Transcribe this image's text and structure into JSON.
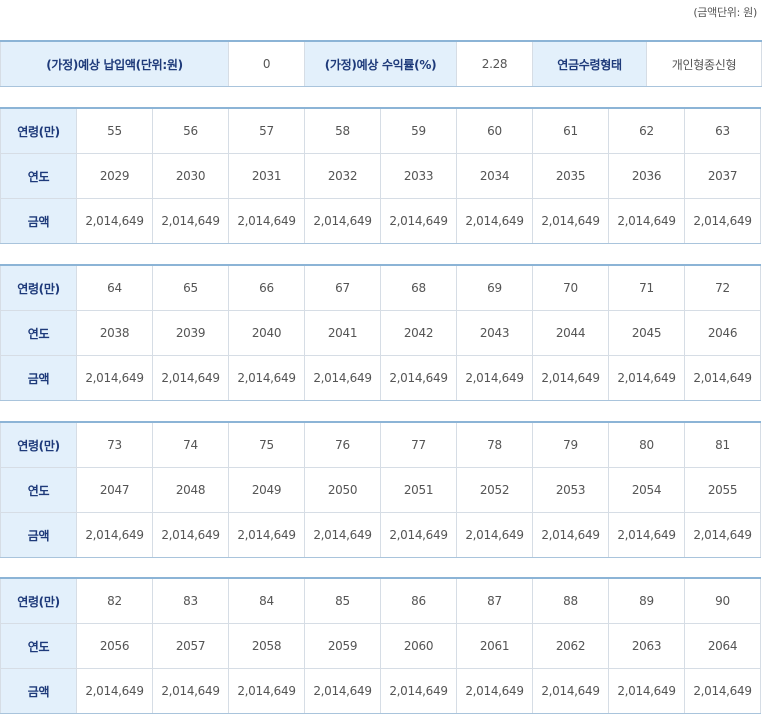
{
  "unit_note": "(금액단위: 원)",
  "summary": {
    "payment_label": "(가정)예상 납입액(단위:원)",
    "payment_value": "0",
    "rate_label": "(가정)예상 수익률(%)",
    "rate_value": "2.28",
    "type_label": "연금수령형태",
    "type_value": "개인형종신형"
  },
  "row_labels": {
    "age": "연령(만)",
    "year": "연도",
    "amount": "금액"
  },
  "blocks": [
    {
      "ages": [
        "55",
        "56",
        "57",
        "58",
        "59",
        "60",
        "61",
        "62",
        "63"
      ],
      "years": [
        "2029",
        "2030",
        "2031",
        "2032",
        "2033",
        "2034",
        "2035",
        "2036",
        "2037"
      ],
      "amounts": [
        "2,014,649",
        "2,014,649",
        "2,014,649",
        "2,014,649",
        "2,014,649",
        "2,014,649",
        "2,014,649",
        "2,014,649",
        "2,014,649"
      ]
    },
    {
      "ages": [
        "64",
        "65",
        "66",
        "67",
        "68",
        "69",
        "70",
        "71",
        "72"
      ],
      "years": [
        "2038",
        "2039",
        "2040",
        "2041",
        "2042",
        "2043",
        "2044",
        "2045",
        "2046"
      ],
      "amounts": [
        "2,014,649",
        "2,014,649",
        "2,014,649",
        "2,014,649",
        "2,014,649",
        "2,014,649",
        "2,014,649",
        "2,014,649",
        "2,014,649"
      ]
    },
    {
      "ages": [
        "73",
        "74",
        "75",
        "76",
        "77",
        "78",
        "79",
        "80",
        "81"
      ],
      "years": [
        "2047",
        "2048",
        "2049",
        "2050",
        "2051",
        "2052",
        "2053",
        "2054",
        "2055"
      ],
      "amounts": [
        "2,014,649",
        "2,014,649",
        "2,014,649",
        "2,014,649",
        "2,014,649",
        "2,014,649",
        "2,014,649",
        "2,014,649",
        "2,014,649"
      ]
    },
    {
      "ages": [
        "82",
        "83",
        "84",
        "85",
        "86",
        "87",
        "88",
        "89",
        "90"
      ],
      "years": [
        "2056",
        "2057",
        "2058",
        "2059",
        "2060",
        "2061",
        "2062",
        "2063",
        "2064"
      ],
      "amounts": [
        "2,014,649",
        "2,014,649",
        "2,014,649",
        "2,014,649",
        "2,014,649",
        "2,014,649",
        "2,014,649",
        "2,014,649",
        "2,014,649"
      ]
    }
  ]
}
